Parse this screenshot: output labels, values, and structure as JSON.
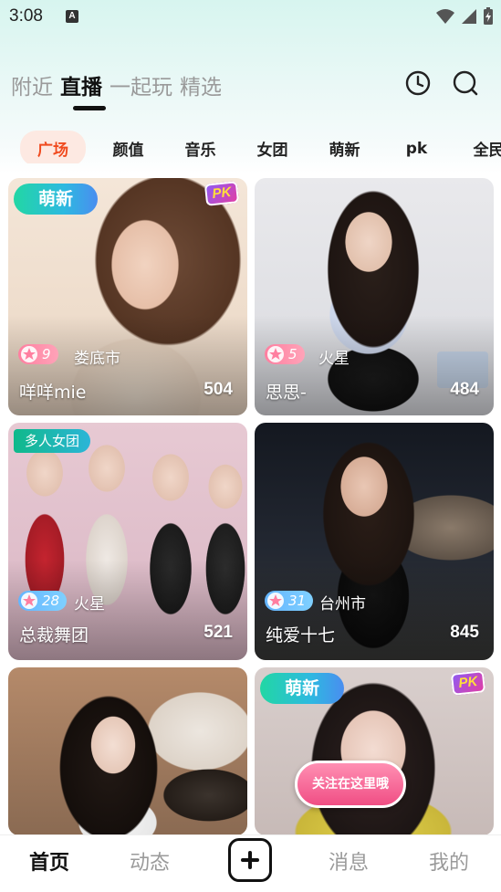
{
  "status": {
    "time": "3:08",
    "notif_letter": "A"
  },
  "top_tabs": [
    {
      "label": "附近",
      "active": false
    },
    {
      "label": "直播",
      "active": true
    },
    {
      "label": "一起玩",
      "active": false
    },
    {
      "label": "精选",
      "active": false
    }
  ],
  "top_actions": [
    "clock-icon",
    "search-icon"
  ],
  "categories": [
    "广场",
    "颜值",
    "音乐",
    "女团",
    "萌新",
    "pk",
    "全民"
  ],
  "active_category": "广场",
  "cards": [
    {
      "badge": "萌新",
      "pk": "PK",
      "level": "9",
      "level_color": "pink",
      "city": "娄底市",
      "name": "咩咩mie",
      "viewers": "504"
    },
    {
      "badge": "",
      "pk": "",
      "level": "5",
      "level_color": "pink",
      "city": "火星",
      "name": "思思-",
      "viewers": "484"
    },
    {
      "badge": "多人女团",
      "pk": "",
      "level": "28",
      "level_color": "blue",
      "city": "火星",
      "name": "总裁舞团",
      "viewers": "521"
    },
    {
      "badge": "",
      "pk": "",
      "level": "31",
      "level_color": "blue",
      "city": "台州市",
      "name": "纯爱十七",
      "viewers": "845"
    },
    {
      "badge": "",
      "pk": "",
      "level": "",
      "city": "",
      "name": "",
      "viewers": ""
    },
    {
      "badge": "萌新",
      "pk": "PK",
      "sticker": "关注在这里哦",
      "level": "",
      "city": "",
      "name": "",
      "viewers": ""
    }
  ],
  "bottom_nav": [
    {
      "label": "首页",
      "active": true
    },
    {
      "label": "动态",
      "active": false
    },
    {
      "label": "消息",
      "active": false
    },
    {
      "label": "我的",
      "active": false
    }
  ],
  "colors": {
    "accent": "#f04b1f",
    "chip_bg": "#fde9e2",
    "badge_green": "#22d7a4"
  }
}
